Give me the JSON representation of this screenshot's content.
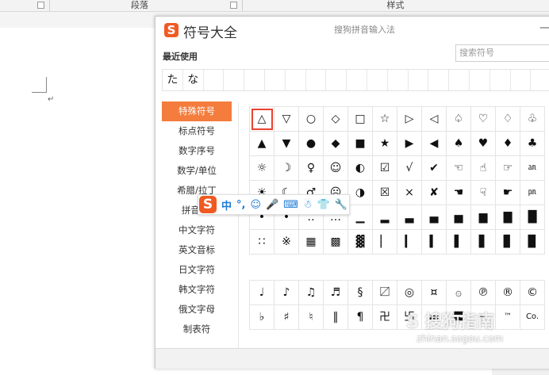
{
  "ribbon": {
    "section_paragraph": "段落",
    "section_styles": "样式"
  },
  "document": {
    "paragraph_mark": "↵"
  },
  "dialog": {
    "title": "符号大全",
    "logo": "S",
    "subtitle": "搜狗拼音输入法",
    "close": "—",
    "recent_label": "最近使用",
    "search_placeholder": "搜索符号",
    "recent": [
      "た",
      "な",
      "",
      "",
      "",
      "",
      "",
      "",
      "",
      "",
      "",
      "",
      "",
      "",
      "",
      "",
      "",
      "",
      ""
    ],
    "categories": [
      "特殊符号",
      "标点符号",
      "数字序号",
      "数学/单位",
      "希腊/拉丁",
      "拼音/注",
      "中文字符",
      "英文音标",
      "日文字符",
      "韩文字符",
      "俄文字母",
      "制表符"
    ],
    "active_category": "特殊符号",
    "grid1": [
      "△",
      "▽",
      "○",
      "◇",
      "□",
      "☆",
      "▷",
      "◁",
      "♤",
      "♡",
      "♢",
      "♧",
      "▲",
      "▼",
      "●",
      "◆",
      "■",
      "★",
      "▶",
      "◀",
      "♠",
      "♥",
      "♦",
      "♣",
      "☼",
      "☽",
      "♀",
      "☺",
      "◐",
      "☑",
      "√",
      "✔",
      "☜",
      "☝",
      "☞",
      "㏂",
      "☀",
      "☾",
      "♂",
      "☹",
      "◑",
      "☒",
      "×",
      "✘",
      "☚",
      "☟",
      "☛",
      "㏘",
      "•",
      "•",
      "‥",
      "…",
      "▁",
      "▂",
      "▃",
      "▄",
      "▅",
      "▆",
      "▇",
      "█",
      "∷",
      "※",
      "▦",
      "▩",
      "▓",
      "▏",
      "▎",
      "▍",
      "▌",
      "▋",
      "▊",
      "▉"
    ],
    "grid2": [
      "♩",
      "♪",
      "♫",
      "♬",
      "§",
      "〼",
      "◎",
      "¤",
      "۞",
      "℗",
      "®",
      "©",
      "♭",
      "♯",
      "♮",
      "‖",
      "¶",
      "卍",
      "卐",
      "▬",
      "〓",
      "℡",
      "™",
      "Co."
    ]
  },
  "ime_toolbar": {
    "logo": "S",
    "items": [
      "中",
      "°,",
      "☺",
      "🎤",
      "⌨",
      "☃",
      "👕",
      "🔧"
    ]
  },
  "watermark": {
    "text": "S 搜狗指南",
    "url": "zhinan.sogou.com"
  }
}
